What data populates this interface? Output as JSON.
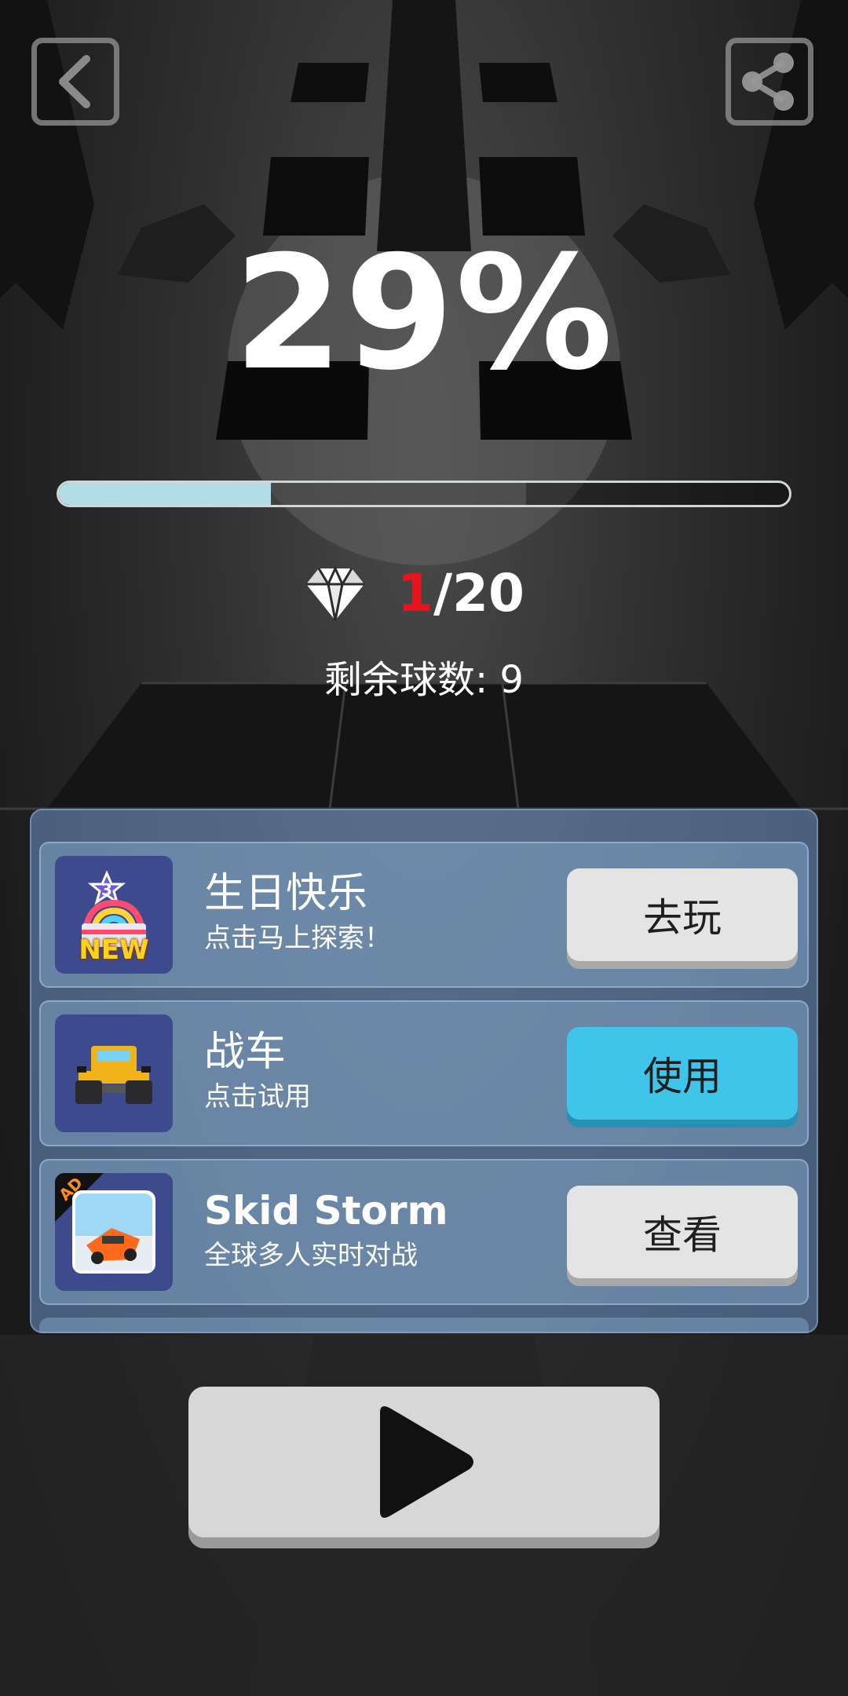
{
  "progress": {
    "percent_text": "29%",
    "fraction": 0.29
  },
  "gems": {
    "collected": "1",
    "total_text": "/20"
  },
  "balls": {
    "label": "剩余球数: 9"
  },
  "cards": [
    {
      "title": "生日快乐",
      "subtitle": "点击马上探索！",
      "button": "去玩",
      "badge": "NEW",
      "level_badge": "3"
    },
    {
      "title": "战车",
      "subtitle": "点击试用",
      "button": "使用"
    },
    {
      "title": "Skid Storm",
      "subtitle": "全球多人实时对战",
      "button": "查看",
      "ad_badge": "AD"
    }
  ],
  "icons": {
    "back": "back-arrow-icon",
    "share": "share-icon",
    "gem": "diamond-icon",
    "play": "play-icon"
  },
  "colors": {
    "progress_fill": "#b3dde6",
    "gem_current": "#e8141b",
    "use_button": "#3fc4ea"
  }
}
